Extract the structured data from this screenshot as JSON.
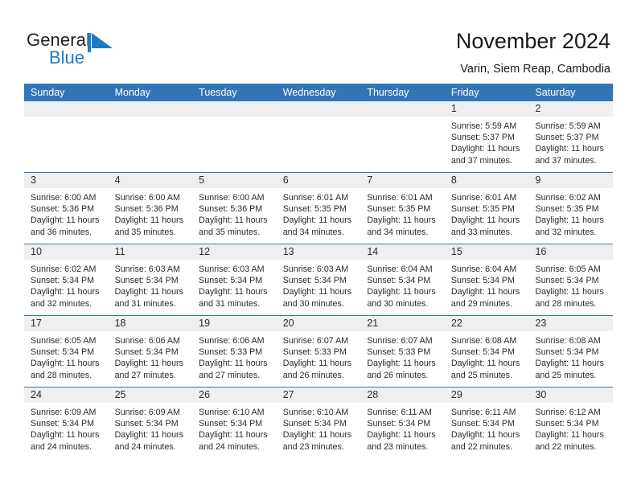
{
  "brand": {
    "name_dark": "General",
    "name_light": "Blue",
    "flag_icon": "blue-triangle-flag-icon",
    "dark_color": "#231f20",
    "accent_color": "#1f7ac4"
  },
  "header": {
    "title": "November 2024",
    "subtitle": "Varin, Siem Reap, Cambodia"
  },
  "theme": {
    "header_bar": "#3276b8",
    "daynum_band": "#efefef",
    "row_rule": "#3276b8",
    "text": "#2b2b2b"
  },
  "weekdays": [
    "Sunday",
    "Monday",
    "Tuesday",
    "Wednesday",
    "Thursday",
    "Friday",
    "Saturday"
  ],
  "weeks": [
    [
      {
        "day": "",
        "lines": []
      },
      {
        "day": "",
        "lines": []
      },
      {
        "day": "",
        "lines": []
      },
      {
        "day": "",
        "lines": []
      },
      {
        "day": "",
        "lines": []
      },
      {
        "day": "1",
        "lines": [
          "Sunrise: 5:59 AM",
          "Sunset: 5:37 PM",
          "Daylight: 11 hours",
          "and 37 minutes."
        ]
      },
      {
        "day": "2",
        "lines": [
          "Sunrise: 5:59 AM",
          "Sunset: 5:37 PM",
          "Daylight: 11 hours",
          "and 37 minutes."
        ]
      }
    ],
    [
      {
        "day": "3",
        "lines": [
          "Sunrise: 6:00 AM",
          "Sunset: 5:36 PM",
          "Daylight: 11 hours",
          "and 36 minutes."
        ]
      },
      {
        "day": "4",
        "lines": [
          "Sunrise: 6:00 AM",
          "Sunset: 5:36 PM",
          "Daylight: 11 hours",
          "and 35 minutes."
        ]
      },
      {
        "day": "5",
        "lines": [
          "Sunrise: 6:00 AM",
          "Sunset: 5:36 PM",
          "Daylight: 11 hours",
          "and 35 minutes."
        ]
      },
      {
        "day": "6",
        "lines": [
          "Sunrise: 6:01 AM",
          "Sunset: 5:35 PM",
          "Daylight: 11 hours",
          "and 34 minutes."
        ]
      },
      {
        "day": "7",
        "lines": [
          "Sunrise: 6:01 AM",
          "Sunset: 5:35 PM",
          "Daylight: 11 hours",
          "and 34 minutes."
        ]
      },
      {
        "day": "8",
        "lines": [
          "Sunrise: 6:01 AM",
          "Sunset: 5:35 PM",
          "Daylight: 11 hours",
          "and 33 minutes."
        ]
      },
      {
        "day": "9",
        "lines": [
          "Sunrise: 6:02 AM",
          "Sunset: 5:35 PM",
          "Daylight: 11 hours",
          "and 32 minutes."
        ]
      }
    ],
    [
      {
        "day": "10",
        "lines": [
          "Sunrise: 6:02 AM",
          "Sunset: 5:34 PM",
          "Daylight: 11 hours",
          "and 32 minutes."
        ]
      },
      {
        "day": "11",
        "lines": [
          "Sunrise: 6:03 AM",
          "Sunset: 5:34 PM",
          "Daylight: 11 hours",
          "and 31 minutes."
        ]
      },
      {
        "day": "12",
        "lines": [
          "Sunrise: 6:03 AM",
          "Sunset: 5:34 PM",
          "Daylight: 11 hours",
          "and 31 minutes."
        ]
      },
      {
        "day": "13",
        "lines": [
          "Sunrise: 6:03 AM",
          "Sunset: 5:34 PM",
          "Daylight: 11 hours",
          "and 30 minutes."
        ]
      },
      {
        "day": "14",
        "lines": [
          "Sunrise: 6:04 AM",
          "Sunset: 5:34 PM",
          "Daylight: 11 hours",
          "and 30 minutes."
        ]
      },
      {
        "day": "15",
        "lines": [
          "Sunrise: 6:04 AM",
          "Sunset: 5:34 PM",
          "Daylight: 11 hours",
          "and 29 minutes."
        ]
      },
      {
        "day": "16",
        "lines": [
          "Sunrise: 6:05 AM",
          "Sunset: 5:34 PM",
          "Daylight: 11 hours",
          "and 28 minutes."
        ]
      }
    ],
    [
      {
        "day": "17",
        "lines": [
          "Sunrise: 6:05 AM",
          "Sunset: 5:34 PM",
          "Daylight: 11 hours",
          "and 28 minutes."
        ]
      },
      {
        "day": "18",
        "lines": [
          "Sunrise: 6:06 AM",
          "Sunset: 5:34 PM",
          "Daylight: 11 hours",
          "and 27 minutes."
        ]
      },
      {
        "day": "19",
        "lines": [
          "Sunrise: 6:06 AM",
          "Sunset: 5:33 PM",
          "Daylight: 11 hours",
          "and 27 minutes."
        ]
      },
      {
        "day": "20",
        "lines": [
          "Sunrise: 6:07 AM",
          "Sunset: 5:33 PM",
          "Daylight: 11 hours",
          "and 26 minutes."
        ]
      },
      {
        "day": "21",
        "lines": [
          "Sunrise: 6:07 AM",
          "Sunset: 5:33 PM",
          "Daylight: 11 hours",
          "and 26 minutes."
        ]
      },
      {
        "day": "22",
        "lines": [
          "Sunrise: 6:08 AM",
          "Sunset: 5:34 PM",
          "Daylight: 11 hours",
          "and 25 minutes."
        ]
      },
      {
        "day": "23",
        "lines": [
          "Sunrise: 6:08 AM",
          "Sunset: 5:34 PM",
          "Daylight: 11 hours",
          "and 25 minutes."
        ]
      }
    ],
    [
      {
        "day": "24",
        "lines": [
          "Sunrise: 6:09 AM",
          "Sunset: 5:34 PM",
          "Daylight: 11 hours",
          "and 24 minutes."
        ]
      },
      {
        "day": "25",
        "lines": [
          "Sunrise: 6:09 AM",
          "Sunset: 5:34 PM",
          "Daylight: 11 hours",
          "and 24 minutes."
        ]
      },
      {
        "day": "26",
        "lines": [
          "Sunrise: 6:10 AM",
          "Sunset: 5:34 PM",
          "Daylight: 11 hours",
          "and 24 minutes."
        ]
      },
      {
        "day": "27",
        "lines": [
          "Sunrise: 6:10 AM",
          "Sunset: 5:34 PM",
          "Daylight: 11 hours",
          "and 23 minutes."
        ]
      },
      {
        "day": "28",
        "lines": [
          "Sunrise: 6:11 AM",
          "Sunset: 5:34 PM",
          "Daylight: 11 hours",
          "and 23 minutes."
        ]
      },
      {
        "day": "29",
        "lines": [
          "Sunrise: 6:11 AM",
          "Sunset: 5:34 PM",
          "Daylight: 11 hours",
          "and 22 minutes."
        ]
      },
      {
        "day": "30",
        "lines": [
          "Sunrise: 6:12 AM",
          "Sunset: 5:34 PM",
          "Daylight: 11 hours",
          "and 22 minutes."
        ]
      }
    ]
  ]
}
